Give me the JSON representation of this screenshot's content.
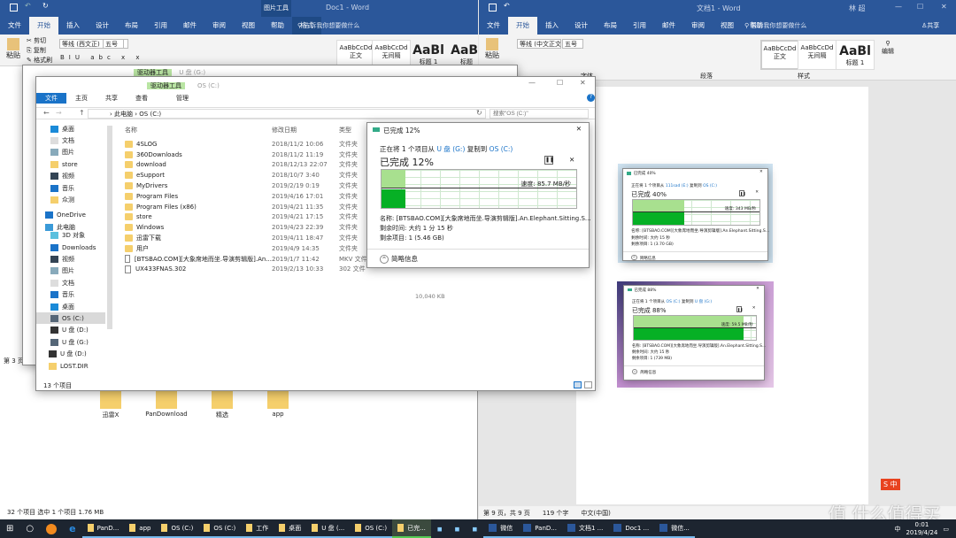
{
  "word_left": {
    "title": "Doc1  -  Word",
    "context_tab_group": "图片工具",
    "tabs": [
      "文件",
      "开始",
      "插入",
      "设计",
      "布局",
      "引用",
      "邮件",
      "审阅",
      "视图",
      "帮助",
      "格式"
    ],
    "active_tab": "开始",
    "tell_me": "告诉我你想要做什么",
    "clipboard": {
      "paste": "粘贴",
      "cut": "剪切",
      "copy": "复制",
      "format_painter": "格式刷"
    },
    "font_name": "等线 (西文正)",
    "font_size": "五号",
    "styles": [
      "AaBbCcDd",
      "AaBbCcDd",
      "AaBl",
      "AaBl"
    ],
    "style_labels": [
      "正文",
      "无间隔",
      "标题 1",
      "标题"
    ],
    "page_status": "第 3 页"
  },
  "word_right": {
    "title": "文档1  -  Word",
    "user": "林 超",
    "share": "共享",
    "tabs": [
      "文件",
      "开始",
      "插入",
      "设计",
      "布局",
      "引用",
      "邮件",
      "审阅",
      "视图",
      "帮助"
    ],
    "active_tab": "开始",
    "tell_me": "告诉我你想要做什么",
    "paste": "粘贴",
    "font_name": "等线 (中文正文)",
    "font_size": "五号",
    "styles": [
      "AaBbCcDd",
      "AaBbCcDd",
      "AaBl"
    ],
    "style_labels": [
      "正文",
      "无间隔",
      "标题 1"
    ],
    "groups": [
      "字体",
      "段落",
      "样式"
    ],
    "edit": "编辑",
    "status": {
      "page": "第 9 页，共 9 页",
      "words": "119 个字",
      "lang": "中文(中国)"
    }
  },
  "explorer_back": {
    "context_tab": "驱动器工具",
    "title": "U 盘 (G:)",
    "status": "32 个项目    选中 1 个项目  1.76 MB"
  },
  "explorer": {
    "context_tab": "驱动器工具",
    "title": "OS (C:)",
    "tabs": [
      "文件",
      "主页",
      "共享",
      "查看"
    ],
    "manage": "管理",
    "breadcrumb": [
      "此电脑",
      "OS (C:)"
    ],
    "search_placeholder": "搜索\"OS (C:)\"",
    "columns": [
      "名称",
      "修改日期",
      "类型"
    ],
    "nav": [
      {
        "label": "桌面",
        "icon": "desktop-icon"
      },
      {
        "label": "文档",
        "icon": "document-icon"
      },
      {
        "label": "图片",
        "icon": "pictures-icon"
      },
      {
        "label": "store",
        "icon": "folder-icon"
      },
      {
        "label": "视频",
        "icon": "video-icon"
      },
      {
        "label": "音乐",
        "icon": "music-icon"
      },
      {
        "label": "众测",
        "icon": "folder-icon"
      },
      {
        "label": "OneDrive",
        "icon": "cloud-icon"
      },
      {
        "label": "此电脑",
        "icon": "computer-icon"
      },
      {
        "label": "3D 对象",
        "icon": "cube-icon"
      },
      {
        "label": "Downloads",
        "icon": "download-icon"
      },
      {
        "label": "视频",
        "icon": "video-icon"
      },
      {
        "label": "图片",
        "icon": "pictures-icon"
      },
      {
        "label": "文档",
        "icon": "document-icon"
      },
      {
        "label": "音乐",
        "icon": "music-icon"
      },
      {
        "label": "桌面",
        "icon": "desktop-icon"
      },
      {
        "label": "OS (C:)",
        "icon": "drive-icon"
      },
      {
        "label": "U 盘 (D:)",
        "icon": "usb-icon"
      },
      {
        "label": "U 盘 (G:)",
        "icon": "drive-icon"
      },
      {
        "label": "U 盘 (D:)",
        "icon": "usb-icon"
      },
      {
        "label": "LOST.DIR",
        "icon": "folder-icon"
      }
    ],
    "files": [
      {
        "name": "4SLOG",
        "date": "2018/11/2 10:06",
        "type": "文件夹",
        "kind": "folder"
      },
      {
        "name": "360Downloads",
        "date": "2018/11/2 11:19",
        "type": "文件夹",
        "kind": "folder"
      },
      {
        "name": "download",
        "date": "2018/12/13 22:07",
        "type": "文件夹",
        "kind": "folder"
      },
      {
        "name": "eSupport",
        "date": "2018/10/7 3:40",
        "type": "文件夹",
        "kind": "folder"
      },
      {
        "name": "MyDrivers",
        "date": "2019/2/19 0:19",
        "type": "文件夹",
        "kind": "folder"
      },
      {
        "name": "Program Files",
        "date": "2019/4/16 17:01",
        "type": "文件夹",
        "kind": "folder"
      },
      {
        "name": "Program Files (x86)",
        "date": "2019/4/21 11:35",
        "type": "文件夹",
        "kind": "folder"
      },
      {
        "name": "store",
        "date": "2019/4/21 17:15",
        "type": "文件夹",
        "kind": "folder"
      },
      {
        "name": "Windows",
        "date": "2019/4/23 22:39",
        "type": "文件夹",
        "kind": "folder"
      },
      {
        "name": "迅雷下载",
        "date": "2019/4/11 18:47",
        "type": "文件夹",
        "kind": "folder"
      },
      {
        "name": "用户",
        "date": "2019/4/9 14:35",
        "type": "文件夹",
        "kind": "folder"
      },
      {
        "name": "[BTSBAO.COM][大象席地而坐.导演剪辑版].An...",
        "date": "2019/1/7 11:42",
        "type": "MKV 文件",
        "kind": "file"
      },
      {
        "name": "UX433FNAS.302",
        "date": "2019/2/13 10:33",
        "type": "302 文件",
        "kind": "file"
      }
    ],
    "extra_size": "10,040 KB",
    "status": "13 个项目"
  },
  "copy_dialog": {
    "title": "已完成 12%",
    "from_prefix": "正在将 1 个项目从",
    "source": "U 盘 (G:)",
    "to_word": "复制到",
    "dest": "OS (C:)",
    "heading": "已完成 12%",
    "progress": 12,
    "speed": "速度: 85.7 MB/秒",
    "name": "名称: [BTSBAO.COM][大象席地而坐.导演剪辑版].An.Elephant.Sitting.S...",
    "time_left": "剩余时间: 大约 1 分 15 秒",
    "items_left": "剩余项目: 1 (5.46 GB)",
    "details": "简略信息"
  },
  "copy_dialog_2": {
    "title": "已完成 40%",
    "from_prefix": "正在将 1 个项目从",
    "source": "111sad (E:)",
    "to_word": "复制到",
    "dest": "OS (C:)",
    "heading": "已完成 40%",
    "progress": 40,
    "speed": "速度: 343 MB/秒",
    "name": "名称: [BTSBAO.COM][大象席地而坐.导演剪辑版].An.Elephant.Sitting.S...",
    "time_left": "剩余时间: 大约 15 秒",
    "items_left": "剩余项目: 1 (3.70 GB)",
    "details": "简略信息"
  },
  "copy_dialog_3": {
    "title": "已完成 88%",
    "from_prefix": "正在将 1 个项目从",
    "source": "OS (C:)",
    "to_word": "复制到",
    "dest": "U 盘 (G:)",
    "heading": "已完成 88%",
    "progress": 88,
    "speed": "速度: 59.5 MB/秒",
    "name": "名称: [BTSBAO.COM][大象席地而坐.导演剪辑版].An.Elephant.Sitting.S...",
    "time_left": "剩余时间: 大约 15 秒",
    "items_left": "剩余项目: 1 (739 MB)",
    "details": "简略信息"
  },
  "desktop_icons": [
    "迅雷X",
    "PanDownload",
    "精选",
    "app"
  ],
  "taskbar": {
    "items": [
      "PanD...",
      "app",
      "OS (C:)",
      "OS (C:)",
      "工作",
      "桌面",
      "U 盘 (...",
      "OS (C:)",
      "已完..."
    ],
    "right_items": [
      "微信",
      "PanD...",
      "文档1 ...",
      "Doc1 ...",
      "微信..."
    ],
    "ime": "中",
    "time": "0:01",
    "date": "2019/4/24"
  },
  "watermark": "值 什么值得买",
  "colors": {
    "word_blue": "#2b579a",
    "progress_green": "#06b025",
    "progress_light": "#a8e08f",
    "context_green": "#b9e5a3",
    "taskbar": "#1d2530"
  }
}
